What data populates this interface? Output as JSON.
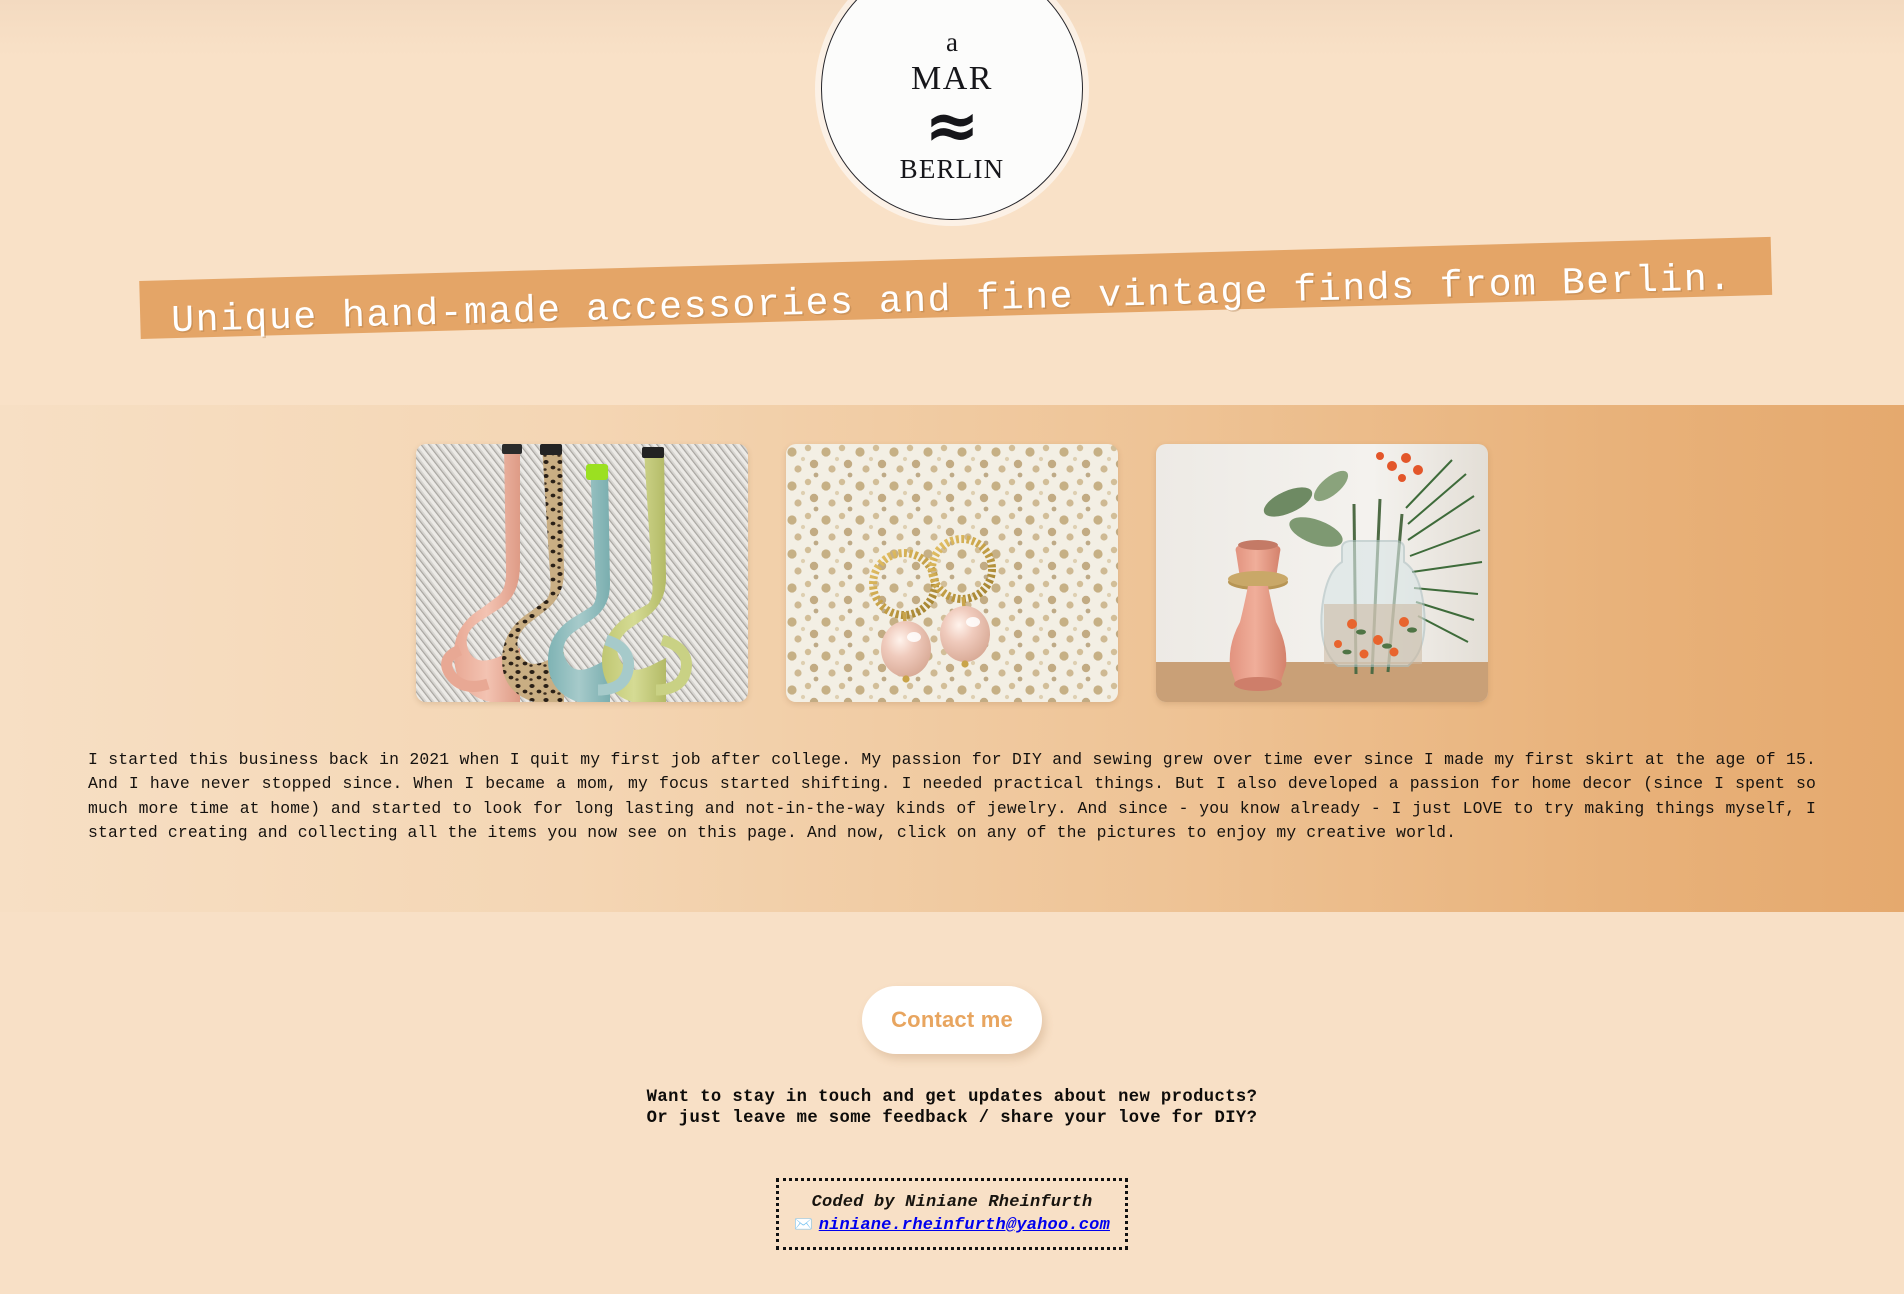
{
  "brand": {
    "logo_line1": "a",
    "logo_line2": "MAR",
    "logo_wave": "≈",
    "logo_line3": "BERLIN",
    "logo_alt": "aMARBERLIN circular logo"
  },
  "hero": {
    "tagline": "Unique hand-made accessories and fine vintage finds from Berlin.",
    "banner_color": "#E4A567",
    "tagline_color": "#FFFFFF"
  },
  "gallery": {
    "items": [
      {
        "name": "hand-made-straps",
        "caption": "Four hand-made bag straps in blush pink, leopard print, teal and olive green laid on a grey woven textile"
      },
      {
        "name": "pearl-hoop-earrings",
        "caption": "A pair of gold beaded hoop earrings with large pink baroque pearl drops on a speckled cream stone surface"
      },
      {
        "name": "vintage-home-decor",
        "caption": "A pink ceramic candle holder with brass ring beside a floral-painted glass vase holding eucalyptus, pine and orange blossoms"
      }
    ]
  },
  "about": {
    "text": "I started this business back in 2021 when I quit my first job after college. My passion for DIY and sewing grew over time ever since I made my first skirt at the age of 15. And I have never stopped since. When I became a mom, my focus started shifting. I needed practical things. But I also developed a passion for home decor (since I spent so much more time at home) and started to look for long lasting and not-in-the-way kinds of jewelry. And since - you know already - I just LOVE to try making things myself, I started creating and collecting all the items you now see on this page. And now, click on any of the pictures to enjoy my creative world."
  },
  "contact": {
    "button_label": "Contact me",
    "button_text_color": "#E8A55F",
    "prompt_line1": "Want to stay in touch and get updates about new products?",
    "prompt_line2": "Or just leave me some feedback / share your love for DIY?"
  },
  "footer": {
    "credit": "Coded by Niniane Rheinfurth",
    "envelope_icon": "✉️",
    "email": "niniane.rheinfurth@yahoo.com",
    "email_color": "#0000EE"
  },
  "theme": {
    "page_background": "#F8E0C6",
    "gradient_left": "#F7DFC4",
    "gradient_right": "#E5A96E",
    "accent": "#E4A567"
  }
}
